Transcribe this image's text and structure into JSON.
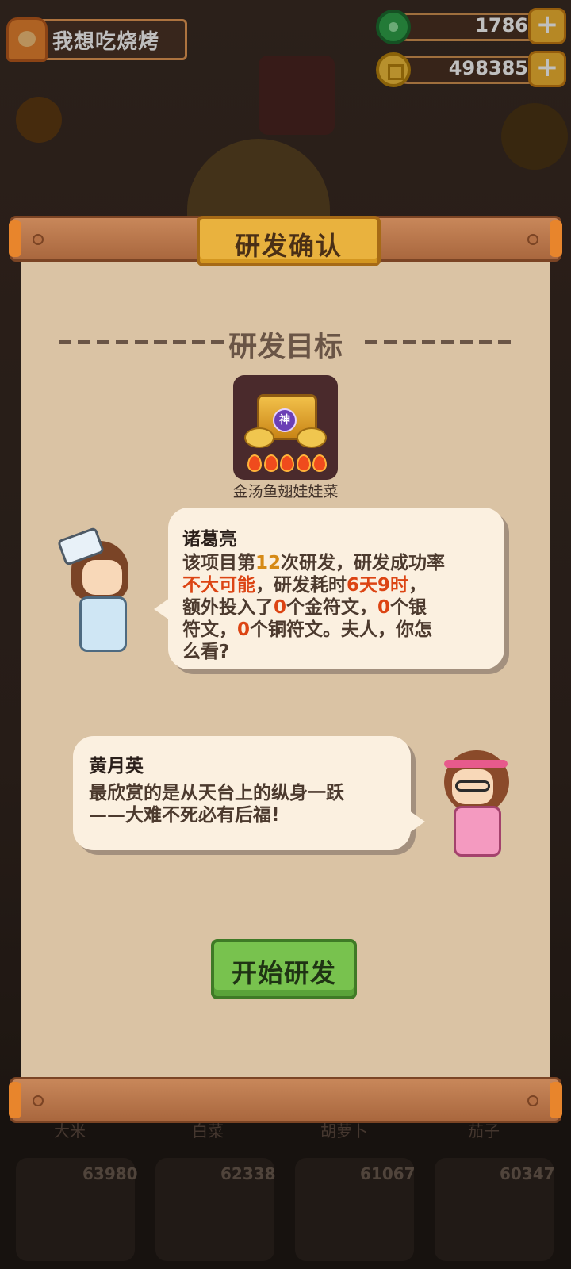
{
  "player": {
    "name": "我想吃烧烤",
    "avatar_icon": "pig-chef-avatar-icon"
  },
  "resources": [
    {
      "name": "jade",
      "icon": "jade-icon",
      "value": "1786",
      "color": "#2fa34a"
    },
    {
      "name": "coin",
      "icon": "coin-icon",
      "value": "498385",
      "color": "#f4c13c"
    }
  ],
  "plus_label": "+",
  "background": {
    "vegetables": [
      {
        "name": "大米",
        "count": "63980"
      },
      {
        "name": "白菜",
        "count": "62338"
      },
      {
        "name": "胡萝卜",
        "count": "61067"
      },
      {
        "name": "茄子",
        "count": "60347"
      }
    ]
  },
  "dialog": {
    "title": "研发确认",
    "section_title": "研发目标",
    "dish": {
      "name": "金汤鱼翅娃娃菜",
      "badge": "神",
      "rating_flames": 5
    },
    "advisor": {
      "speaker": "诸葛亮",
      "line1_prefix": "该项目第",
      "attempt": "12",
      "line1_suffix": "次研发，研发成功率",
      "probability": "不大可能",
      "line2_mid": "，研发耗时",
      "duration": "6天9时",
      "line2_end": "，",
      "line3_prefix": "额外投入了",
      "gold_count": "0",
      "line3_mid": "个金符文，",
      "silver_count": "0",
      "line3_end": "个银",
      "line4_prefix": "符文，",
      "copper_count": "0",
      "line4_suffix": "个铜符文。夫人，你怎",
      "line5": "么看?"
    },
    "wife": {
      "speaker": "黄月英",
      "line1": "最欣赏的是从天台上的纵身一跃",
      "line2": "——大难不死必有后福!"
    },
    "start_button": "开始研发"
  },
  "colors": {
    "highlight_yellow": "#d68a16",
    "highlight_red": "#dc4413",
    "button_green": "#78c24e",
    "title_gold": "#e9b23e"
  }
}
